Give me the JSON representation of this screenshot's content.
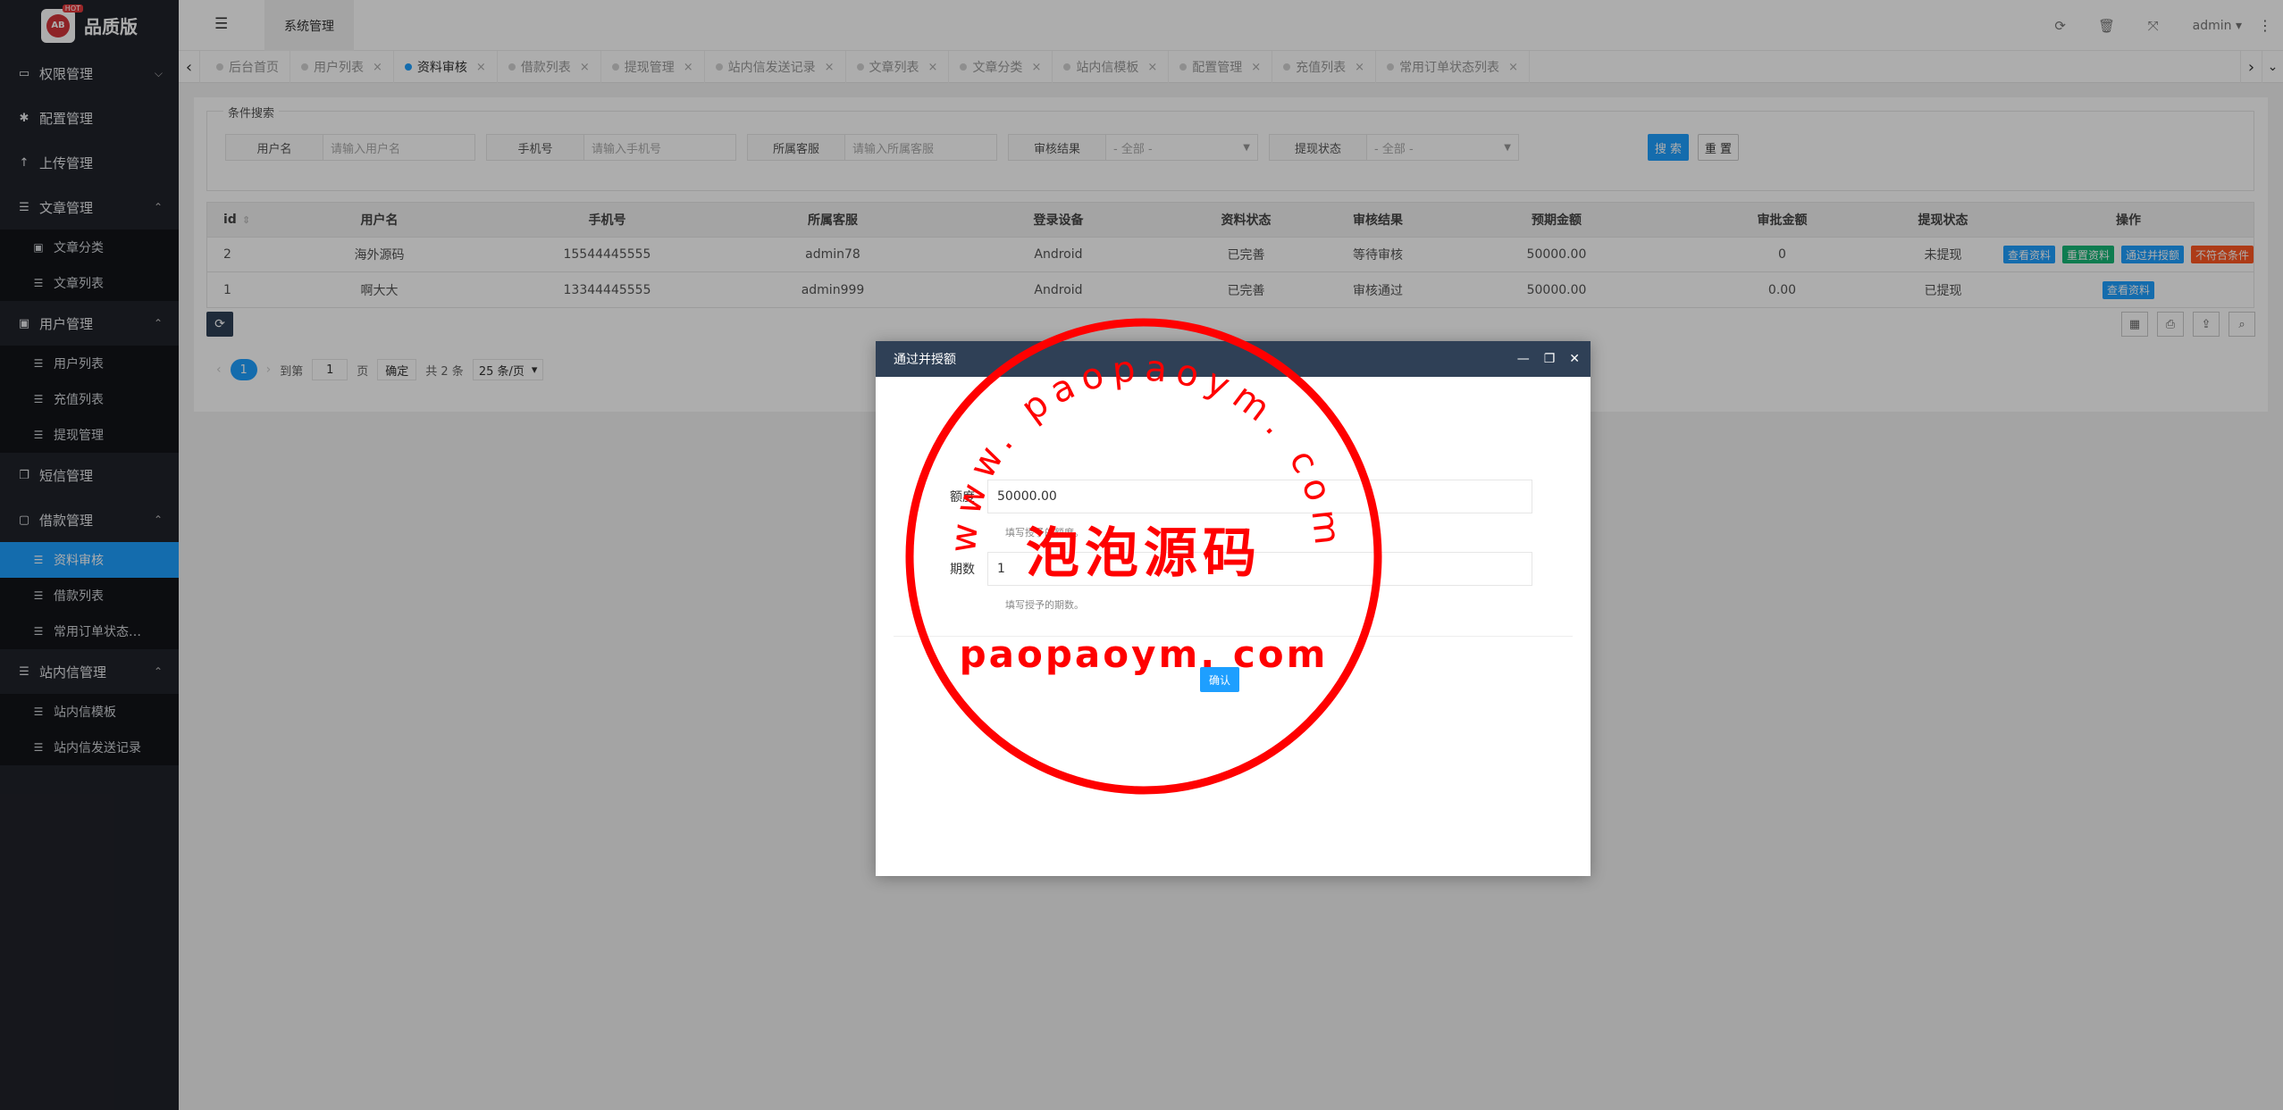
{
  "brand": {
    "name": "品质版",
    "badge_text": "AB",
    "badge_tag": "HOT"
  },
  "sidebar": {
    "groups": [
      {
        "label": "权限管理",
        "icon": "laptop-icon",
        "glyph": "▭",
        "chev": "⌵",
        "children": []
      },
      {
        "label": "配置管理",
        "icon": "gear-icon",
        "glyph": "✱",
        "chev": "",
        "children": []
      },
      {
        "label": "上传管理",
        "icon": "upload-icon",
        "glyph": "↑",
        "chev": "",
        "children": []
      },
      {
        "label": "文章管理",
        "icon": "list-icon",
        "glyph": "☰",
        "chev": "⌃",
        "children": [
          {
            "label": "文章分类",
            "glyph": "▣",
            "icon": "calendar-icon",
            "active": false
          },
          {
            "label": "文章列表",
            "glyph": "☰",
            "icon": "list-icon",
            "active": false
          }
        ]
      },
      {
        "label": "用户管理",
        "icon": "user-card-icon",
        "glyph": "▣",
        "chev": "⌃",
        "children": [
          {
            "label": "用户列表",
            "glyph": "☰",
            "icon": "list-icon",
            "active": false
          },
          {
            "label": "充值列表",
            "glyph": "☰",
            "icon": "list-icon",
            "active": false
          },
          {
            "label": "提现管理",
            "glyph": "☰",
            "icon": "list-icon",
            "active": false
          }
        ]
      },
      {
        "label": "短信管理",
        "icon": "copy-icon",
        "glyph": "❐",
        "chev": "",
        "children": []
      },
      {
        "label": "借款管理",
        "icon": "money-icon",
        "glyph": "▢",
        "chev": "⌃",
        "children": [
          {
            "label": "资料审核",
            "glyph": "☰",
            "icon": "list-icon",
            "active": true
          },
          {
            "label": "借款列表",
            "glyph": "☰",
            "icon": "list-icon",
            "active": false
          },
          {
            "label": "常用订单状态…",
            "glyph": "☰",
            "icon": "list-icon",
            "active": false
          }
        ]
      },
      {
        "label": "站内信管理",
        "icon": "list-icon",
        "glyph": "☰",
        "chev": "⌃",
        "children": [
          {
            "label": "站内信模板",
            "glyph": "☰",
            "icon": "list-icon",
            "active": false
          },
          {
            "label": "站内信发送记录",
            "glyph": "☰",
            "icon": "list-icon",
            "active": false
          }
        ]
      }
    ]
  },
  "header": {
    "toggle_glyph": "☰",
    "tab_label": "系统管理",
    "user": "admin",
    "user_caret": "▾",
    "more_glyph": "⋮",
    "icons": [
      {
        "name": "refresh-icon",
        "glyph": "⟳"
      },
      {
        "name": "trash-icon",
        "glyph": "🗑"
      },
      {
        "name": "fullscreen-icon",
        "glyph": "⤧"
      }
    ]
  },
  "tabs": {
    "prev_glyph": "‹",
    "next_glyph": "›",
    "menu_glyph": "⌄",
    "close_glyph": "×",
    "items": [
      {
        "label": "后台首页",
        "active": false,
        "closable": false
      },
      {
        "label": "用户列表",
        "active": false,
        "closable": true
      },
      {
        "label": "资料审核",
        "active": true,
        "closable": true
      },
      {
        "label": "借款列表",
        "active": false,
        "closable": true
      },
      {
        "label": "提现管理",
        "active": false,
        "closable": true
      },
      {
        "label": "站内信发送记录",
        "active": false,
        "closable": true
      },
      {
        "label": "文章列表",
        "active": false,
        "closable": true
      },
      {
        "label": "文章分类",
        "active": false,
        "closable": true
      },
      {
        "label": "站内信模板",
        "active": false,
        "closable": true
      },
      {
        "label": "配置管理",
        "active": false,
        "closable": true
      },
      {
        "label": "充值列表",
        "active": false,
        "closable": true
      },
      {
        "label": "常用订单状态列表",
        "active": false,
        "closable": true
      }
    ]
  },
  "search": {
    "legend": "条件搜索",
    "username": {
      "label": "用户名",
      "placeholder": "请输入用户名"
    },
    "phone": {
      "label": "手机号",
      "placeholder": "请输入手机号"
    },
    "staff": {
      "label": "所属客服",
      "placeholder": "请输入所属客服"
    },
    "audit": {
      "label": "审核结果",
      "value": "- 全部 -"
    },
    "withdraw": {
      "label": "提现状态",
      "value": "- 全部 -"
    },
    "search_button": "搜 索",
    "reset_button": "重 置"
  },
  "table": {
    "sort_glyph": "⇕",
    "headers": {
      "id": "id",
      "user": "用户名",
      "phone": "手机号",
      "staff": "所属客服",
      "device": "登录设备",
      "state": "资料状态",
      "audit": "审核结果",
      "amount": "预期金额",
      "approved": "审批金额",
      "withdraw": "提现状态",
      "ops": "操作"
    },
    "rows": [
      {
        "id": "2",
        "user": "海外源码",
        "phone": "15544445555",
        "staff": "admin78",
        "device": "Android",
        "state": "已完善",
        "audit": "等待审核",
        "amount": "50000.00",
        "approved": "0",
        "withdraw": "未提现",
        "ops": [
          {
            "label": "查看资料",
            "color": "blue"
          },
          {
            "label": "重置资料",
            "color": "green"
          },
          {
            "label": "通过并授额",
            "color": "blue"
          },
          {
            "label": "不符合条件",
            "color": "red"
          }
        ]
      },
      {
        "id": "1",
        "user": "啊大大",
        "phone": "13344445555",
        "staff": "admin999",
        "device": "Android",
        "state": "已完善",
        "audit": "审核通过",
        "amount": "50000.00",
        "approved": "0.00",
        "withdraw": "已提现",
        "ops": [
          {
            "label": "查看资料",
            "color": "blue"
          }
        ]
      }
    ]
  },
  "toolbar": {
    "refresh_glyph": "⟳",
    "tools": [
      {
        "name": "columns-icon",
        "glyph": "▦"
      },
      {
        "name": "print-icon",
        "glyph": "⎙"
      },
      {
        "name": "export-icon",
        "glyph": "⇪"
      },
      {
        "name": "search-icon",
        "glyph": "⌕"
      }
    ]
  },
  "pager": {
    "prev_glyph": "‹",
    "next_glyph": "›",
    "current": "1",
    "goto_label": "到第",
    "goto_value": "1",
    "page_unit": "页",
    "confirm": "确定",
    "total": "共 2 条",
    "size": "25 条/页",
    "size_caret": "▾"
  },
  "modal": {
    "title": "通过并授额",
    "ctrl_min": "—",
    "ctrl_max": "❐",
    "ctrl_close": "✕",
    "quota": {
      "label": "额度",
      "value": "50000.00",
      "tip": "填写授予的额度。"
    },
    "periods": {
      "label": "期数",
      "value": "1",
      "tip": "填写授予的期数。"
    },
    "confirm": "确认"
  },
  "watermark": {
    "arc_text": "www. paopaoym. com",
    "center_text": "泡泡源码",
    "bottom_text": "paopaoym. com",
    "color": "#ff0000"
  },
  "colors": {
    "accent": "#1e9fff",
    "sidebar": "#20222a",
    "modal_header": "#2f4056",
    "green": "#16b777",
    "red": "#ff5722"
  }
}
